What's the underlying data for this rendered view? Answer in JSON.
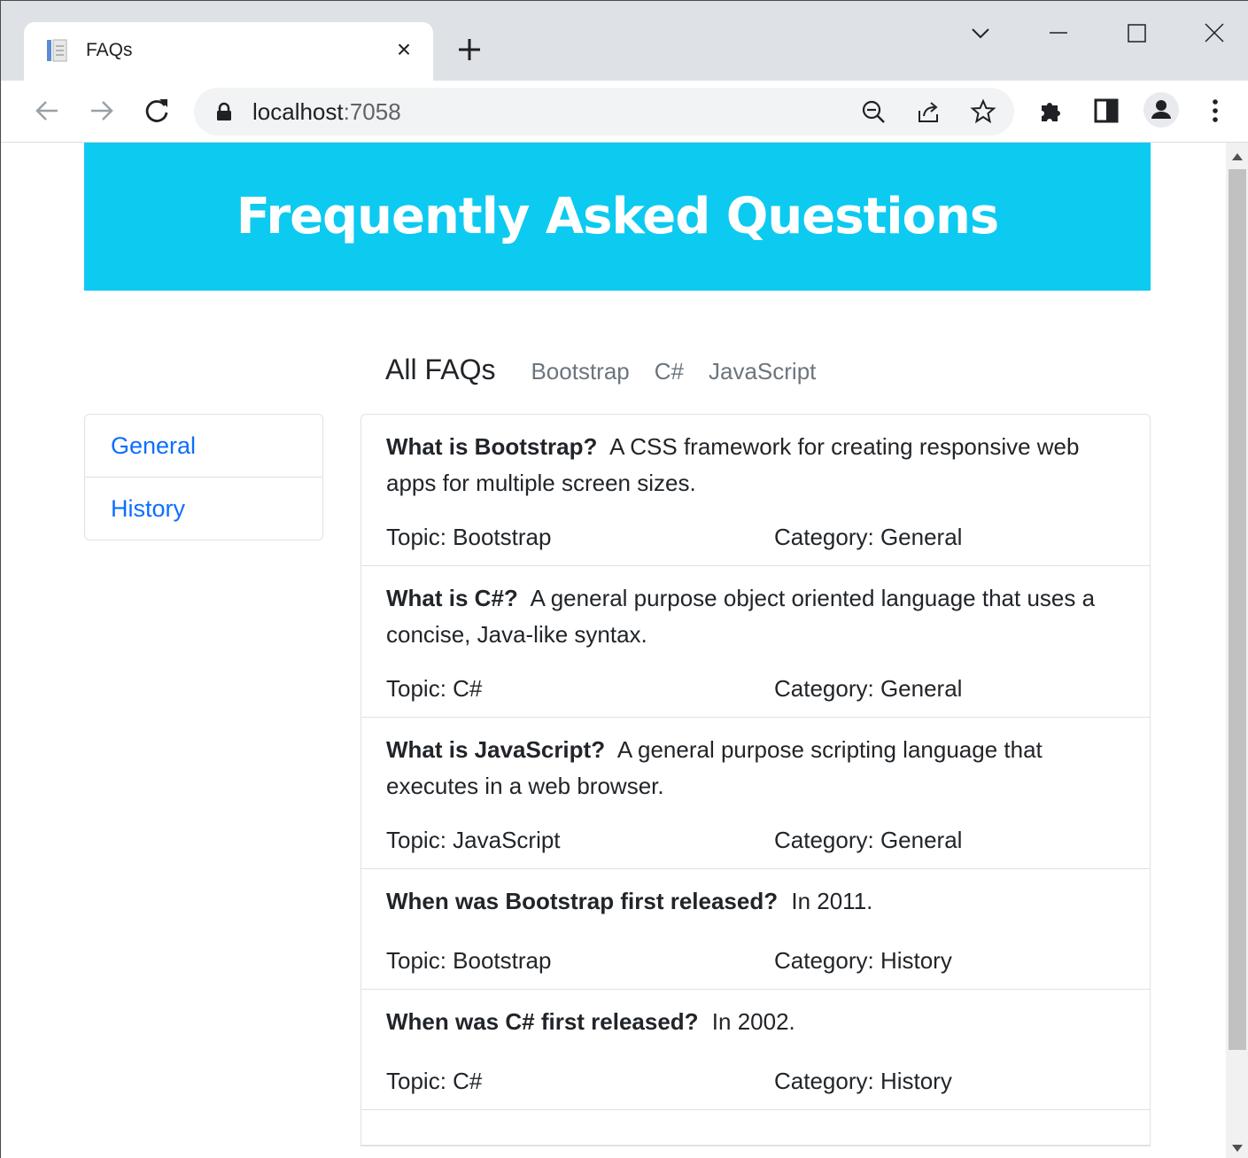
{
  "browser": {
    "tab_title": "FAQs",
    "tab_close": "×",
    "url_host": "localhost",
    "url_port": ":7058"
  },
  "page": {
    "heading": "Frequently Asked Questions",
    "topics": {
      "active": "All FAQs",
      "links": [
        "Bootstrap",
        "C#",
        "JavaScript"
      ]
    },
    "categories": [
      "General",
      "History"
    ],
    "faqs": [
      {
        "question": "What is Bootstrap?",
        "answer": "A CSS framework for creating responsive web apps for multiple screen sizes.",
        "topic": "Topic: Bootstrap",
        "category": "Category: General"
      },
      {
        "question": "What is C#?",
        "answer": "A general purpose object oriented language that uses a concise, Java-like syntax.",
        "topic": "Topic: C#",
        "category": "Category: General"
      },
      {
        "question": "What is JavaScript?",
        "answer": "A general purpose scripting language that executes in a web browser.",
        "topic": "Topic: JavaScript",
        "category": "Category: General"
      },
      {
        "question": "When was Bootstrap first released?",
        "answer": "In 2011.",
        "topic": "Topic: Bootstrap",
        "category": "Category: History"
      },
      {
        "question": "When was C# first released?",
        "answer": "In 2002.",
        "topic": "Topic: C#",
        "category": "Category: History"
      }
    ]
  },
  "colors": {
    "jumbotron": "#0dcaf0",
    "link": "#0d6efd",
    "muted": "#6c757d"
  }
}
